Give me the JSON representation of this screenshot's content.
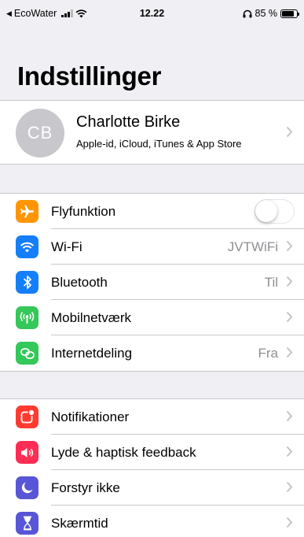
{
  "status_bar": {
    "back_label": "EcoWater",
    "time": "12.22",
    "battery": "85 %",
    "battery_level": 0.85
  },
  "title": "Indstillinger",
  "profile": {
    "initials": "CB",
    "name": "Charlotte Birke",
    "subtitle": "Apple-id, iCloud, iTunes & App Store"
  },
  "group1": [
    {
      "label": "Flyfunktion",
      "icon": "airplane-icon",
      "color": "#ff9500",
      "toggle": false
    },
    {
      "label": "Wi-Fi",
      "icon": "wifi-icon",
      "color": "#147efb",
      "value": "JVTWiFi"
    },
    {
      "label": "Bluetooth",
      "icon": "bluetooth-icon",
      "color": "#147efb",
      "value": "Til"
    },
    {
      "label": "Mobilnetværk",
      "icon": "antenna-icon",
      "color": "#34c759",
      "value": ""
    },
    {
      "label": "Internetdeling",
      "icon": "hotspot-icon",
      "color": "#34c759",
      "value": "Fra"
    }
  ],
  "group2": [
    {
      "label": "Notifikationer",
      "icon": "notifications-icon",
      "color": "#ff3b30"
    },
    {
      "label": "Lyde & haptisk feedback",
      "icon": "sound-icon",
      "color": "#ff2d55"
    },
    {
      "label": "Forstyr ikke",
      "icon": "moon-icon",
      "color": "#5856d6"
    },
    {
      "label": "Skærmtid",
      "icon": "hourglass-icon",
      "color": "#5856d6"
    }
  ]
}
